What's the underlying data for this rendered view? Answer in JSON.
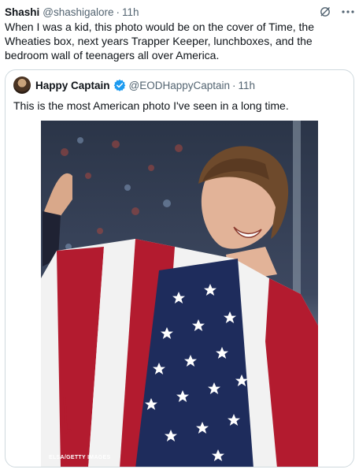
{
  "tweet": {
    "author_name": "Shashi",
    "handle": "@shashigalore",
    "separator": "·",
    "time": "11h",
    "text": "When I was a kid, this photo would be on the cover of Time, the Wheaties box, next years Trapper Keeper, lunchboxes, and the bedroom wall of teenagers all over America."
  },
  "quote": {
    "author_name": "Happy Captain",
    "handle": "@EODHappyCaptain",
    "separator": "·",
    "time": "11h",
    "text": "This is the most American photo I've seen in a long time.",
    "photo_credit": "ELSA/GETTY IMAGES"
  },
  "icons": {
    "grok": "slash-circle-icon",
    "more": "more-icon",
    "verified": "verified-badge-icon"
  },
  "colors": {
    "verified_blue": "#1d9bf0",
    "secondary_text": "#536471",
    "border": "#cfd9de",
    "flag_red": "#b31b2f",
    "flag_blue": "#1e2c5c"
  }
}
